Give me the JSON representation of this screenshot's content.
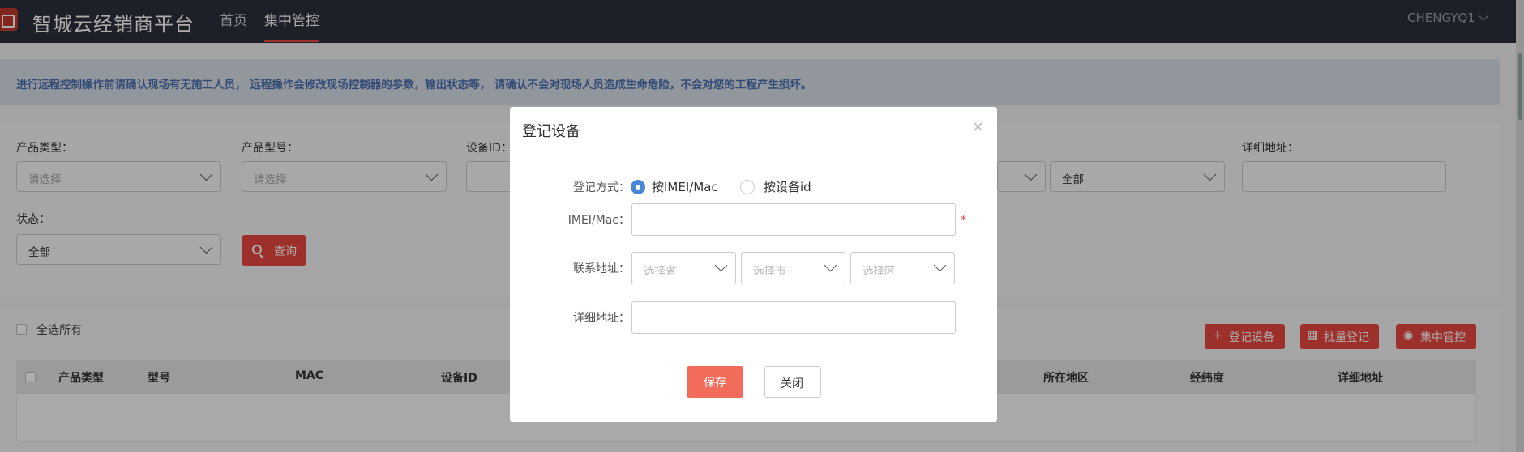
{
  "header": {
    "brand": "智城云经销商平台",
    "nav": [
      "首页",
      "集中管控"
    ],
    "user": "CHENGYQ1"
  },
  "warning": "进行远程控制操作前请确认现场有无施工人员， 远程操作会修改现场控制器的参数，输出状态等， 请确认不会对现场人员造成生命危险，不会对您的工程产生损坏。",
  "filters": {
    "product_type": {
      "label": "产品类型：",
      "placeholder": "请选择"
    },
    "product_model": {
      "label": "产品型号：",
      "placeholder": "请选择"
    },
    "device_id": {
      "label": "设备ID："
    },
    "region_value": "全部",
    "detail_address": {
      "label": "详细地址："
    },
    "status": {
      "label": "状态：",
      "value": "全部"
    },
    "query_label": "查询"
  },
  "list": {
    "select_all": "全选所有",
    "actions": [
      "登记设备",
      "批量登记",
      "集中管控"
    ],
    "columns": [
      "产品类型",
      "型号",
      "MAC",
      "设备ID",
      "所在地区",
      "经纬度",
      "详细地址"
    ]
  },
  "modal": {
    "title": "登记设备",
    "close": "×",
    "method_label": "登记方式：",
    "method_options": [
      "按IMEI/Mac",
      "按设备id"
    ],
    "method_selected": "按IMEI/Mac",
    "imei_label": "IMEI/Mac：",
    "required_mark": "*",
    "address_label": "联系地址：",
    "address_placeholders": [
      "选择省",
      "选择市",
      "选择区"
    ],
    "detail_label": "详细地址：",
    "save": "保存",
    "cancel": "关闭"
  },
  "colors": {
    "topbar": "#2b303b",
    "accent": "#e8483f",
    "radio": "#4a86d8",
    "warning_text": "#4a6fae"
  }
}
